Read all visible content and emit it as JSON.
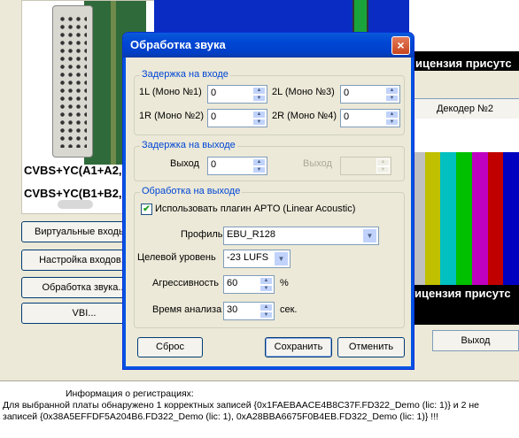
{
  "background": {
    "card_labels": [
      "CVBS+YC(A1+A2,",
      "CVBS+YC(B1+B2,"
    ],
    "side_buttons": [
      "Виртуальные входы...",
      "Настройка входов...",
      "Обработка звука...",
      "VBI..."
    ],
    "license_text": "ицензия присутс",
    "decoder_button": "Декодер №2",
    "exit_button": "Выход",
    "registration": {
      "title": "Информация о регистрациях:",
      "line1": "Для выбранной платы обнаружено 1 корректных записей {0x1FAEBAACE4B8C37F.FD322_Demo (lic: 1)} и 2 не",
      "line2": "записей {0x38A5EFFDF5A204B6.FD322_Demo (lic: 1), 0xA28BBA6675F0B4EB.FD322_Demo (lic: 1)} !!!"
    },
    "color_bars": [
      "#c0c0c0",
      "#c0c000",
      "#00c0c0",
      "#00c000",
      "#c000c0",
      "#c00000",
      "#0000c0"
    ]
  },
  "dialog": {
    "title": "Обработка звука",
    "close_glyph": "×",
    "input_delay": {
      "title": "Задержка на входе",
      "fields": [
        {
          "label": "1L (Моно №1)",
          "value": "0"
        },
        {
          "label": "2L (Моно №3)",
          "value": "0"
        },
        {
          "label": "1R (Моно №2)",
          "value": "0"
        },
        {
          "label": "2R (Моно №4)",
          "value": "0"
        }
      ]
    },
    "output_delay": {
      "title": "Задержка на выходе",
      "output_label": "Выход",
      "output_value": "0",
      "output2_label": "Выход",
      "output2_value": ""
    },
    "output_processing": {
      "title": "Обработка на выходе",
      "checkbox_label": "Использовать плагин APTO (Linear Acoustic)",
      "checked": true,
      "profile_label": "Профиль",
      "profile_value": "EBU_R128",
      "target_label": "Целевой уровень",
      "target_value": "-23 LUFS",
      "aggressiveness_label": "Агрессивность",
      "aggressiveness_value": "60",
      "aggressiveness_unit": "%",
      "analysis_label": "Время анализа",
      "analysis_value": "30",
      "analysis_unit": "сек."
    },
    "buttons": {
      "reset": "Сброс",
      "save": "Сохранить",
      "cancel": "Отменить"
    }
  }
}
